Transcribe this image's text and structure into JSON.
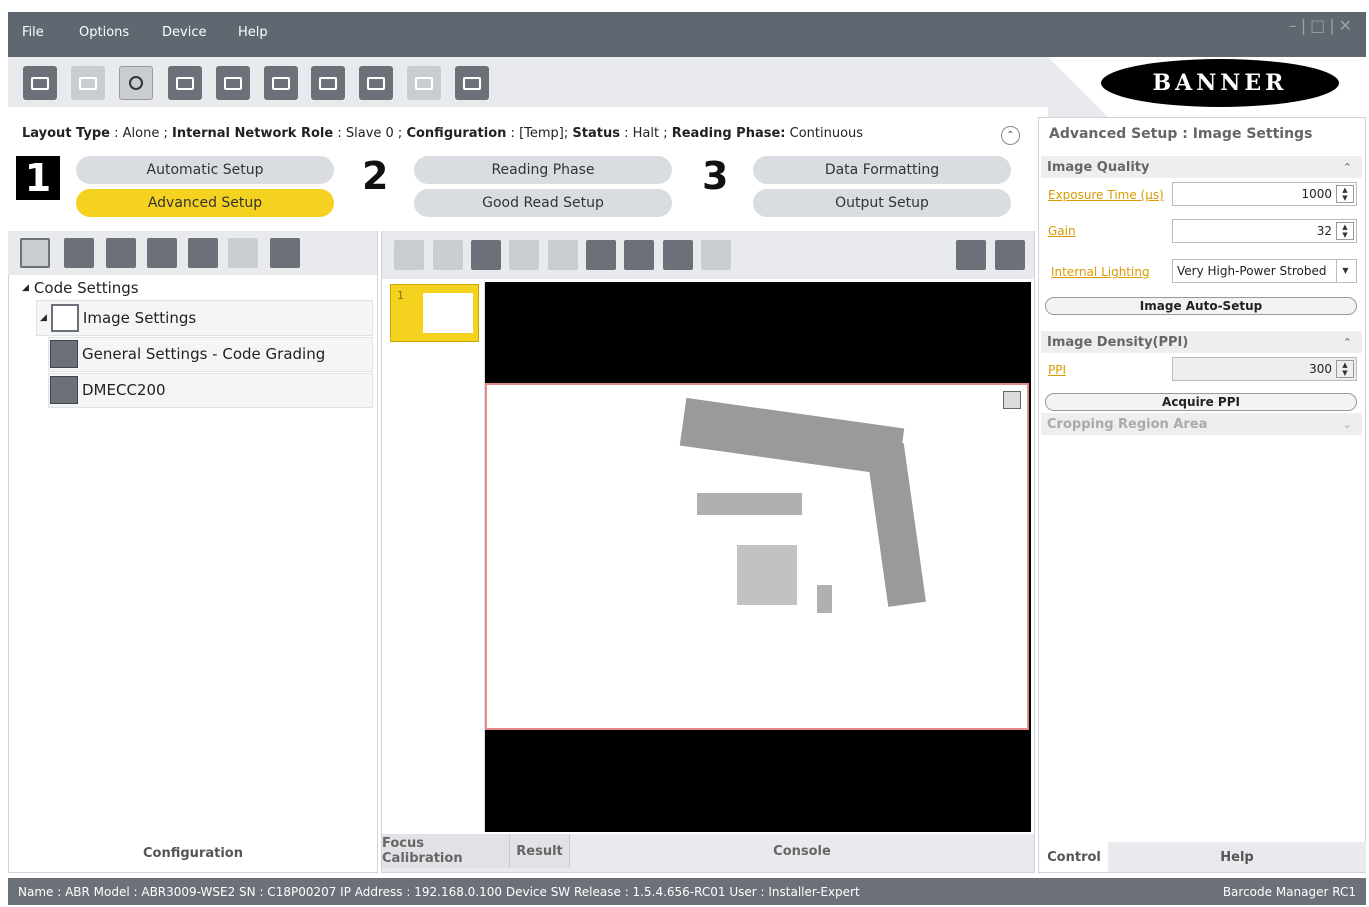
{
  "window": {
    "menu": [
      "File",
      "Options",
      "Device",
      "Help"
    ],
    "controls": "–|□|✕",
    "logo_text": "BANNER"
  },
  "status_line": {
    "layout_type_label": "Layout Type",
    "layout_type_value": "Alone",
    "network_role_label": "Internal Network Role",
    "network_role_value": "Slave 0",
    "configuration_label": "Configuration",
    "configuration_value": "[Temp]",
    "status_label": "Status",
    "status_value": "Halt",
    "reading_phase_label": "Reading Phase:",
    "reading_phase_value": "Continuous"
  },
  "steps": {
    "step1_number": "1",
    "step2_number": "2",
    "step3_number": "3",
    "automatic_setup": "Automatic Setup",
    "advanced_setup": "Advanced Setup",
    "reading_phase": "Reading Phase",
    "good_read_setup": "Good Read Setup",
    "data_formatting": "Data Formatting",
    "output_setup": "Output Setup"
  },
  "tree": {
    "root": "Code Settings",
    "image_settings": "Image Settings",
    "general_settings": "General Settings - Code Grading",
    "dmecc": "DMECC200"
  },
  "panels": {
    "configuration_label": "Configuration",
    "thumb_index": "1",
    "tab_focus": "Focus Calibration",
    "tab_result": "Result",
    "tab_console": "Console"
  },
  "right": {
    "title": "Advanced Setup :  Image Settings",
    "image_quality": "Image Quality",
    "exposure_label": "Exposure Time (µs)",
    "exposure_value": "1000",
    "gain_label": "Gain",
    "gain_value": "32",
    "lighting_label": "Internal Lighting",
    "lighting_value": "Very High-Power Strobed",
    "auto_setup_btn": "Image Auto-Setup",
    "density_hdr": "Image Density(PPI)",
    "ppi_label": "PPI",
    "ppi_value": "300",
    "acquire_btn": "Acquire PPI",
    "cropping_hdr": "Cropping Region Area",
    "tab_control": "Control",
    "tab_help": "Help"
  },
  "statusbar": {
    "info": "Name : ABR   Model : ABR3009-WSE2   SN : C18P00207   IP Address :  192.168.0.100   Device SW Release : 1.5.4.656-RC01   User : Installer-Expert",
    "app": "Barcode Manager RC1"
  },
  "colors": {
    "accent_yellow": "#f5d21f",
    "chrome_gray": "#5f6770",
    "link_orange": "#d89b00",
    "roi_border": "#e58a8a"
  },
  "icons": {
    "toolbar": [
      "device-icon",
      "search-device-icon",
      "user-settings-icon",
      "window-icon",
      "send-config-icon",
      "save-config-icon",
      "export-icon",
      "import-icon",
      "copy-icon",
      "network-icon"
    ],
    "left_toolbar": [
      "add-code-icon",
      "barcode-icon",
      "datamatrix-icon",
      "postal-code-icon",
      "filter-icon",
      "delete-icon",
      "autolearn-icon"
    ],
    "image_toolbar": [
      "arrow-up-icon",
      "arrow-down-icon",
      "zoom-in-icon",
      "zoom-fit-icon",
      "zoom-out-icon",
      "save-image-icon",
      "check-icon",
      "crop-icon",
      "grid-icon",
      "play-icon",
      "step-icon"
    ]
  }
}
